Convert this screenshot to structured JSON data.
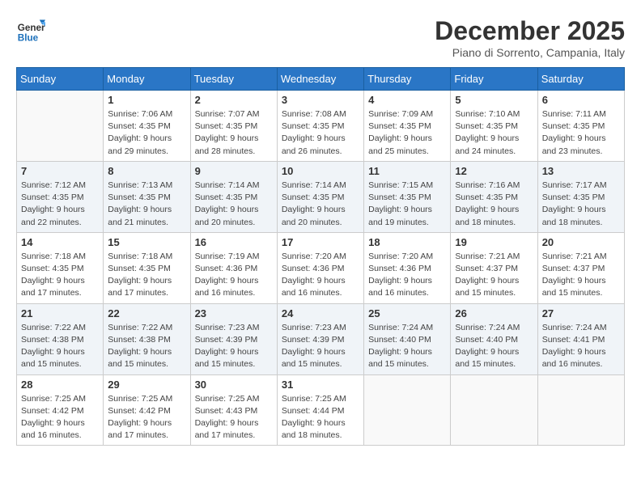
{
  "header": {
    "logo_line1": "General",
    "logo_line2": "Blue",
    "month_title": "December 2025",
    "location": "Piano di Sorrento, Campania, Italy"
  },
  "weekdays": [
    "Sunday",
    "Monday",
    "Tuesday",
    "Wednesday",
    "Thursday",
    "Friday",
    "Saturday"
  ],
  "weeks": [
    [
      {
        "day": "",
        "sunrise": "",
        "sunset": "",
        "daylight": ""
      },
      {
        "day": "1",
        "sunrise": "Sunrise: 7:06 AM",
        "sunset": "Sunset: 4:35 PM",
        "daylight": "Daylight: 9 hours and 29 minutes."
      },
      {
        "day": "2",
        "sunrise": "Sunrise: 7:07 AM",
        "sunset": "Sunset: 4:35 PM",
        "daylight": "Daylight: 9 hours and 28 minutes."
      },
      {
        "day": "3",
        "sunrise": "Sunrise: 7:08 AM",
        "sunset": "Sunset: 4:35 PM",
        "daylight": "Daylight: 9 hours and 26 minutes."
      },
      {
        "day": "4",
        "sunrise": "Sunrise: 7:09 AM",
        "sunset": "Sunset: 4:35 PM",
        "daylight": "Daylight: 9 hours and 25 minutes."
      },
      {
        "day": "5",
        "sunrise": "Sunrise: 7:10 AM",
        "sunset": "Sunset: 4:35 PM",
        "daylight": "Daylight: 9 hours and 24 minutes."
      },
      {
        "day": "6",
        "sunrise": "Sunrise: 7:11 AM",
        "sunset": "Sunset: 4:35 PM",
        "daylight": "Daylight: 9 hours and 23 minutes."
      }
    ],
    [
      {
        "day": "7",
        "sunrise": "Sunrise: 7:12 AM",
        "sunset": "Sunset: 4:35 PM",
        "daylight": "Daylight: 9 hours and 22 minutes."
      },
      {
        "day": "8",
        "sunrise": "Sunrise: 7:13 AM",
        "sunset": "Sunset: 4:35 PM",
        "daylight": "Daylight: 9 hours and 21 minutes."
      },
      {
        "day": "9",
        "sunrise": "Sunrise: 7:14 AM",
        "sunset": "Sunset: 4:35 PM",
        "daylight": "Daylight: 9 hours and 20 minutes."
      },
      {
        "day": "10",
        "sunrise": "Sunrise: 7:14 AM",
        "sunset": "Sunset: 4:35 PM",
        "daylight": "Daylight: 9 hours and 20 minutes."
      },
      {
        "day": "11",
        "sunrise": "Sunrise: 7:15 AM",
        "sunset": "Sunset: 4:35 PM",
        "daylight": "Daylight: 9 hours and 19 minutes."
      },
      {
        "day": "12",
        "sunrise": "Sunrise: 7:16 AM",
        "sunset": "Sunset: 4:35 PM",
        "daylight": "Daylight: 9 hours and 18 minutes."
      },
      {
        "day": "13",
        "sunrise": "Sunrise: 7:17 AM",
        "sunset": "Sunset: 4:35 PM",
        "daylight": "Daylight: 9 hours and 18 minutes."
      }
    ],
    [
      {
        "day": "14",
        "sunrise": "Sunrise: 7:18 AM",
        "sunset": "Sunset: 4:35 PM",
        "daylight": "Daylight: 9 hours and 17 minutes."
      },
      {
        "day": "15",
        "sunrise": "Sunrise: 7:18 AM",
        "sunset": "Sunset: 4:35 PM",
        "daylight": "Daylight: 9 hours and 17 minutes."
      },
      {
        "day": "16",
        "sunrise": "Sunrise: 7:19 AM",
        "sunset": "Sunset: 4:36 PM",
        "daylight": "Daylight: 9 hours and 16 minutes."
      },
      {
        "day": "17",
        "sunrise": "Sunrise: 7:20 AM",
        "sunset": "Sunset: 4:36 PM",
        "daylight": "Daylight: 9 hours and 16 minutes."
      },
      {
        "day": "18",
        "sunrise": "Sunrise: 7:20 AM",
        "sunset": "Sunset: 4:36 PM",
        "daylight": "Daylight: 9 hours and 16 minutes."
      },
      {
        "day": "19",
        "sunrise": "Sunrise: 7:21 AM",
        "sunset": "Sunset: 4:37 PM",
        "daylight": "Daylight: 9 hours and 15 minutes."
      },
      {
        "day": "20",
        "sunrise": "Sunrise: 7:21 AM",
        "sunset": "Sunset: 4:37 PM",
        "daylight": "Daylight: 9 hours and 15 minutes."
      }
    ],
    [
      {
        "day": "21",
        "sunrise": "Sunrise: 7:22 AM",
        "sunset": "Sunset: 4:38 PM",
        "daylight": "Daylight: 9 hours and 15 minutes."
      },
      {
        "day": "22",
        "sunrise": "Sunrise: 7:22 AM",
        "sunset": "Sunset: 4:38 PM",
        "daylight": "Daylight: 9 hours and 15 minutes."
      },
      {
        "day": "23",
        "sunrise": "Sunrise: 7:23 AM",
        "sunset": "Sunset: 4:39 PM",
        "daylight": "Daylight: 9 hours and 15 minutes."
      },
      {
        "day": "24",
        "sunrise": "Sunrise: 7:23 AM",
        "sunset": "Sunset: 4:39 PM",
        "daylight": "Daylight: 9 hours and 15 minutes."
      },
      {
        "day": "25",
        "sunrise": "Sunrise: 7:24 AM",
        "sunset": "Sunset: 4:40 PM",
        "daylight": "Daylight: 9 hours and 15 minutes."
      },
      {
        "day": "26",
        "sunrise": "Sunrise: 7:24 AM",
        "sunset": "Sunset: 4:40 PM",
        "daylight": "Daylight: 9 hours and 15 minutes."
      },
      {
        "day": "27",
        "sunrise": "Sunrise: 7:24 AM",
        "sunset": "Sunset: 4:41 PM",
        "daylight": "Daylight: 9 hours and 16 minutes."
      }
    ],
    [
      {
        "day": "28",
        "sunrise": "Sunrise: 7:25 AM",
        "sunset": "Sunset: 4:42 PM",
        "daylight": "Daylight: 9 hours and 16 minutes."
      },
      {
        "day": "29",
        "sunrise": "Sunrise: 7:25 AM",
        "sunset": "Sunset: 4:42 PM",
        "daylight": "Daylight: 9 hours and 17 minutes."
      },
      {
        "day": "30",
        "sunrise": "Sunrise: 7:25 AM",
        "sunset": "Sunset: 4:43 PM",
        "daylight": "Daylight: 9 hours and 17 minutes."
      },
      {
        "day": "31",
        "sunrise": "Sunrise: 7:25 AM",
        "sunset": "Sunset: 4:44 PM",
        "daylight": "Daylight: 9 hours and 18 minutes."
      },
      {
        "day": "",
        "sunrise": "",
        "sunset": "",
        "daylight": ""
      },
      {
        "day": "",
        "sunrise": "",
        "sunset": "",
        "daylight": ""
      },
      {
        "day": "",
        "sunrise": "",
        "sunset": "",
        "daylight": ""
      }
    ]
  ]
}
